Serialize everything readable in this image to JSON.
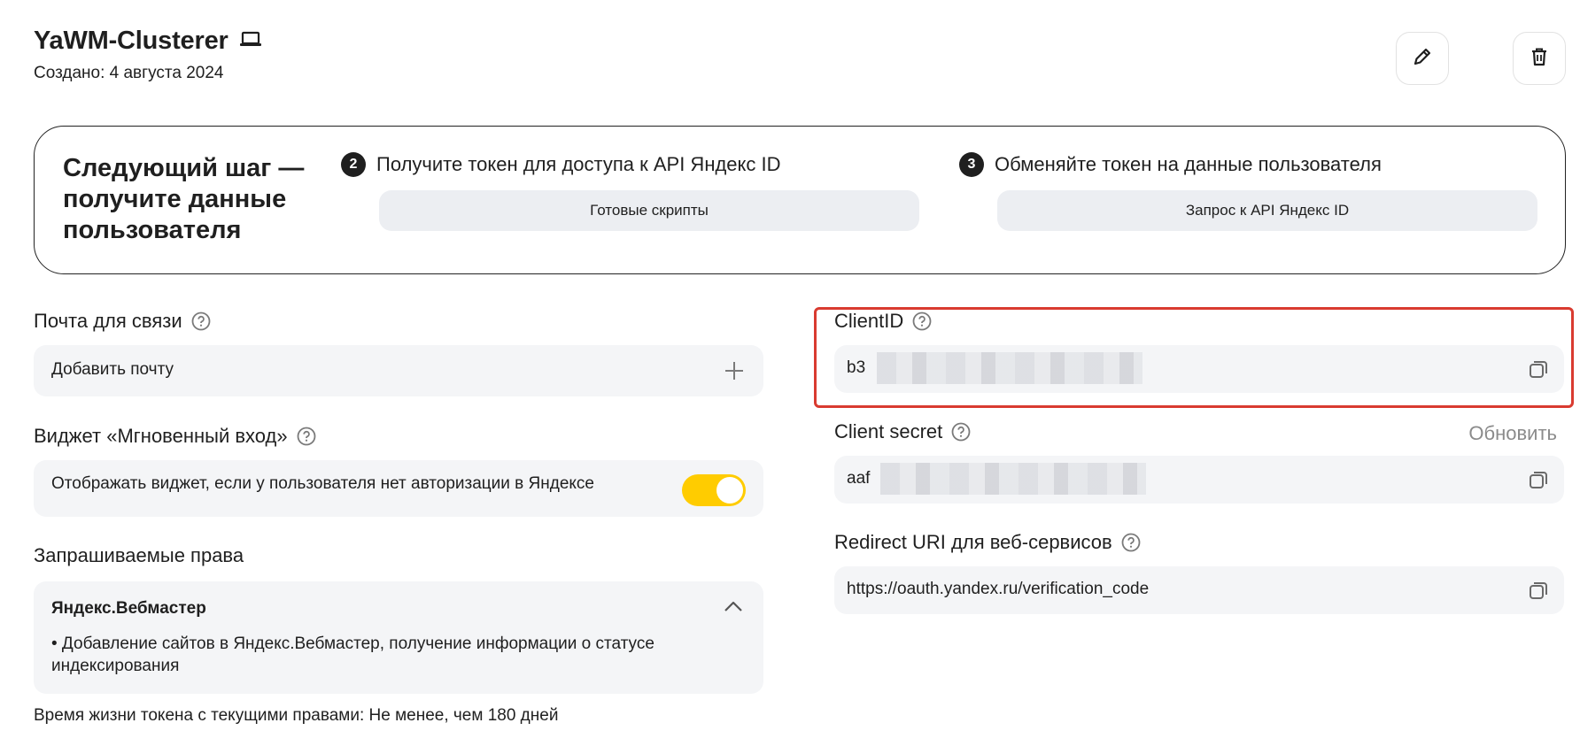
{
  "app": {
    "title": "YaWM-Clusterer",
    "created": "Создано: 4 августа 2024"
  },
  "next_step": {
    "title": "Следующий шаг — получите данные пользователя",
    "step2": {
      "number": "2",
      "text": "Получите токен для доступа к API Яндекс ID",
      "button": "Готовые скрипты"
    },
    "step3": {
      "number": "3",
      "text": "Обменяйте токен на данные пользователя",
      "button": "Запрос к API Яндекс ID"
    }
  },
  "email": {
    "label": "Почта для связи",
    "placeholder": "Добавить почту"
  },
  "widget": {
    "label": "Виджет «Мгновенный вход»",
    "text": "Отображать виджет, если у пользователя нет авторизации в Яндексе",
    "enabled": true
  },
  "rights": {
    "label": "Запрашиваемые права",
    "service": "Яндекс.Вебмастер",
    "description": "• Добавление сайтов в Яндекс.Вебмастер, получение информации о статусе индексирования"
  },
  "lifetime": "Время жизни токена с текущими правами: Не менее, чем 180 дней",
  "client_id": {
    "label": "ClientID",
    "value_prefix": "b3"
  },
  "client_secret": {
    "label": "Client secret",
    "update": "Обновить",
    "value_prefix": "aaf"
  },
  "redirect": {
    "label": "Redirect URI для веб-сервисов",
    "value": "https://oauth.yandex.ru/verification_code"
  },
  "colors": {
    "accent_yellow": "#ffcc00",
    "highlight_red": "#d93b30",
    "field_bg": "#f4f5f7"
  }
}
